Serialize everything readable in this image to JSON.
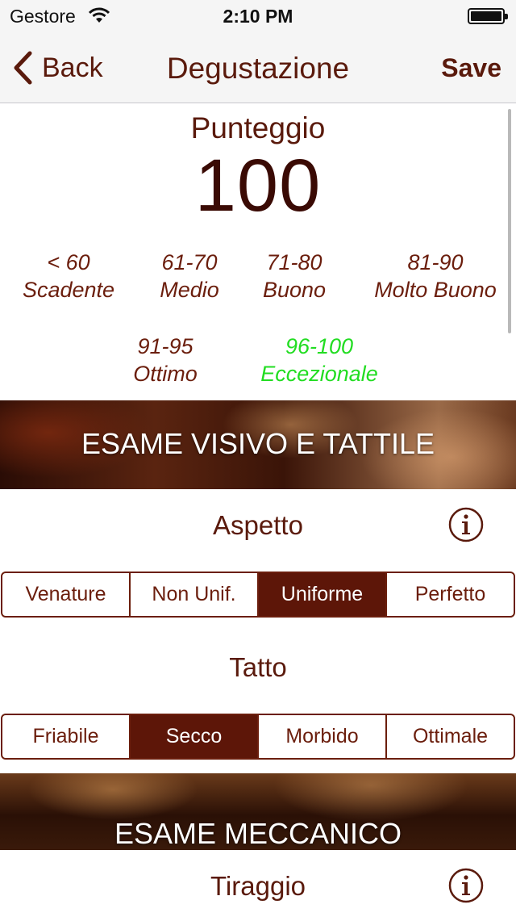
{
  "status_bar": {
    "carrier": "Gestore",
    "time": "2:10 PM",
    "battery_level": 1.0
  },
  "nav": {
    "back_label": "Back",
    "title": "Degustazione",
    "save_label": "Save"
  },
  "score": {
    "label": "Punteggio",
    "value": "100"
  },
  "ranges": [
    {
      "range": "< 60",
      "label": "Scadente",
      "highlighted": false
    },
    {
      "range": "61-70",
      "label": "Medio",
      "highlighted": false
    },
    {
      "range": "71-80",
      "label": "Buono",
      "highlighted": false
    },
    {
      "range": "81-90",
      "label": "Molto Buono",
      "highlighted": false
    },
    {
      "range": "91-95",
      "label": "Ottimo",
      "highlighted": false
    },
    {
      "range": "96-100",
      "label": "Eccezionale",
      "highlighted": true
    }
  ],
  "sections": [
    {
      "title": "ESAME VISIVO E TATTILE"
    },
    {
      "title": "ESAME MECCANICO"
    }
  ],
  "criteria": [
    {
      "title": "Aspetto",
      "options": [
        "Venature",
        "Non Unif.",
        "Uniforme",
        "Perfetto"
      ],
      "selected_index": 2
    },
    {
      "title": "Tatto",
      "options": [
        "Friabile",
        "Secco",
        "Morbido",
        "Ottimale"
      ],
      "selected_index": 1
    },
    {
      "title": "Tiraggio"
    }
  ],
  "colors": {
    "accent": "#5d1608",
    "highlight": "#22dd22",
    "text": "#5a1a0c"
  }
}
